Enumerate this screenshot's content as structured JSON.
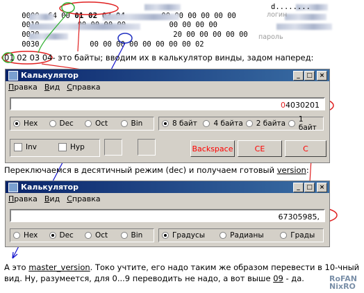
{
  "hexdump": {
    "rows": [
      {
        "addr": "0000",
        "pre": "64 00",
        "bytes": "01 02 03 04",
        "post": "00 00 00 00 00 00",
        "ascii": "d........"
      },
      {
        "addr": "0010",
        "pre": "",
        "bytes": "00 00 00 00",
        "post": "00 00 00 00",
        "ascii": ""
      },
      {
        "addr": "0020",
        "pre": "",
        "bytes": "",
        "post": "20 00 00 00 00 00",
        "ascii": ""
      },
      {
        "addr": "0030",
        "pre": "",
        "bytes": "00 00 00 00 00 00 00 00",
        "post": "02",
        "ascii": ""
      }
    ],
    "login_label": "логин",
    "password_label": "пароль"
  },
  "annotations": {
    "bytes_highlight": "01 02 03 04",
    "line1": "- это байты; вводим их в калькулятор винды, задом наперед:",
    "line2_prefix": "Переключаемся в десятичный режим (dec) и получаем готовый ",
    "line2_link": "version",
    "line2_suffix": ":",
    "line3_prefix": "А это ",
    "line3_link": "master_version",
    "line3_mid": ". Токо учтите, его надо таким же образом перевести в 10-чный",
    "line4_prefix": "вид. Ну, разумеется, для 0...9 переводить не надо, а вот выше ",
    "line4_link": "09",
    "line4_suffix": " - да."
  },
  "calc1": {
    "title": "Калькулятор",
    "menu": [
      "Правка",
      "Вид",
      "Справка"
    ],
    "display_prefix": "0",
    "display_value": "4030201",
    "radix": [
      "Hex",
      "Dec",
      "Oct",
      "Bin"
    ],
    "radix_selected": "Hex",
    "word": [
      "8 байт",
      "4 байта",
      "2 байта",
      "1 байт"
    ],
    "word_selected": "8 байт",
    "checks": [
      "Inv",
      "Hyp"
    ],
    "buttons": [
      "Backspace",
      "CE",
      "C"
    ]
  },
  "calc2": {
    "title": "Калькулятор",
    "menu": [
      "Правка",
      "Вид",
      "Справка"
    ],
    "display_value": "67305985,",
    "radix": [
      "Hex",
      "Dec",
      "Oct",
      "Bin"
    ],
    "radix_selected": "Dec",
    "angle": [
      "Градусы",
      "Радианы",
      "Грады"
    ],
    "angle_selected": "Градусы"
  },
  "watermark": [
    "RoFAN",
    "NixRO"
  ],
  "colors": {
    "title_start": "#0a246a",
    "title_end": "#3a6ea5",
    "face": "#d4d0c8",
    "accent_red": "#ff0000",
    "accent_blue": "#1010cc",
    "accent_green": "#30b030"
  }
}
